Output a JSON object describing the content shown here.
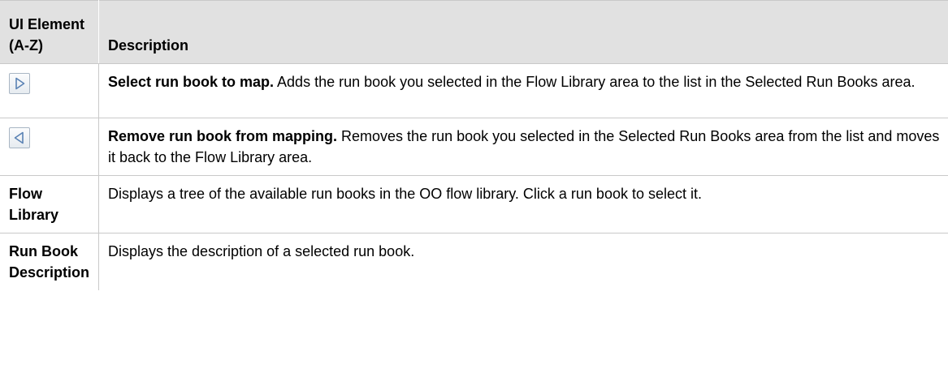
{
  "table": {
    "header": {
      "col1": "UI Element (A-Z)",
      "col2": "Description"
    },
    "rows": [
      {
        "element_icon": "right-arrow-icon",
        "bold": "Select run book to map.",
        "text": " Adds the run book you selected in the Flow Library area to the list in the Selected Run Books area."
      },
      {
        "element_icon": "left-arrow-icon",
        "bold": "Remove run book from mapping.",
        "text": " Removes the run book you selected in the Selected Run Books area from the list and moves it back to the Flow Library area."
      },
      {
        "element": "Flow Library",
        "text": "Displays a tree of the available run books in the OO flow library. Click a run book to select it."
      },
      {
        "element": "Run Book Description",
        "text": "Displays the description of a selected run book."
      }
    ]
  }
}
